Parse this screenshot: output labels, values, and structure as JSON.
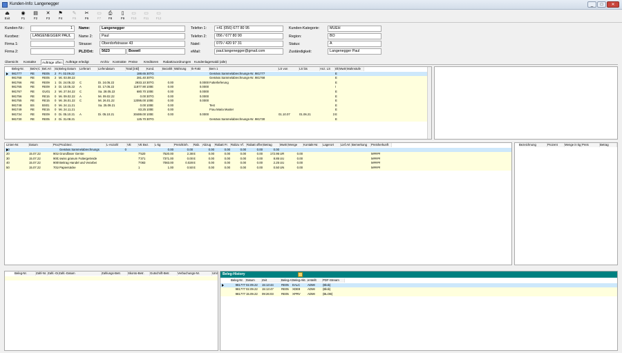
{
  "window": {
    "title": "Kunden-Info: Langenegger",
    "min": "_",
    "max": "□",
    "close": "✕"
  },
  "toolbar": [
    {
      "label": "Exit",
      "icon": "exit-icon",
      "glyph": "⏏",
      "enabled": true
    },
    {
      "label": "F1",
      "icon": "binoculars-icon",
      "glyph": "◉",
      "enabled": true
    },
    {
      "label": "F2",
      "icon": "new-icon",
      "glyph": "▤",
      "enabled": true
    },
    {
      "label": "F3",
      "icon": "delete-icon",
      "glyph": "✕",
      "enabled": true
    },
    {
      "label": "F4",
      "icon": "flag-icon",
      "glyph": "⚑",
      "enabled": true
    },
    {
      "label": "F5",
      "icon": "pin-icon",
      "glyph": "✎",
      "enabled": false
    },
    {
      "label": "F6",
      "icon": "tools-icon",
      "glyph": "✂",
      "enabled": true
    },
    {
      "label": "F7",
      "icon": "disabled-icon",
      "glyph": "▭",
      "enabled": false
    },
    {
      "label": "F8",
      "icon": "print-icon",
      "glyph": "⎙",
      "enabled": true
    },
    {
      "label": "F9",
      "icon": "document-icon",
      "glyph": "▯",
      "enabled": true
    },
    {
      "label": "F10",
      "icon": "disabled-icon",
      "glyph": "▭",
      "enabled": false
    },
    {
      "label": "F11",
      "icon": "disabled-icon",
      "glyph": "▭",
      "enabled": false
    },
    {
      "label": "F12",
      "icon": "disabled-icon",
      "glyph": "▭",
      "enabled": false
    }
  ],
  "customer": {
    "kundennr_label": "Kunden-Nr.:",
    "kundennr": "1",
    "kurzbez_label": "Kurzbez:",
    "kurzbez": "LANGENEGGER PAUL",
    "firma1_label": "Firma 1:",
    "firma1": "",
    "firma2_label": "Firma 2:",
    "firma2": "",
    "name_label": "Name:",
    "name": "Langenegger",
    "name2_label": "Name 2:",
    "name2": "Paul",
    "strasse_label": "Strasse:",
    "strasse": "Oberdorfstrasse 43",
    "plz_label": "PLZ/Ort:",
    "plz": "5623",
    "ort": "Boswil",
    "tel1_label": "Telefon 1:",
    "tel1": "+41 (056) 677 80 95",
    "tel2_label": "Telefon 2:",
    "tel2": "056 / 677 80 90",
    "natel_label": "Natel:",
    "natel": "079 / 420 97 31",
    "email_label": "eMail:",
    "email": "paul.langenegger@gmail.com",
    "kategorie_label": "Kunden-Kategorie:",
    "kategorie": "MUEH",
    "region_label": "Region:",
    "region": "BO",
    "status_label": "Status:",
    "status": "A",
    "zustaendig_label": "Zuständigkeit:",
    "zustaendig": "Langenegger Paul"
  },
  "tabs": [
    "Übersicht",
    "Kontakte",
    "Aufträge offen",
    "Aufträge erledigt",
    "Archiv",
    "Kontrakte",
    "Preise",
    "Kreditoren",
    "Rabattzuordnungen",
    "Kundenlagersaldi (alle)"
  ],
  "active_tab": 2,
  "orders": {
    "columns": [
      "Beleg-Nr.",
      "BelArt",
      "C",
      "Bel.Art",
      "Stat",
      "Beleg Datum",
      "Lieferart",
      "Liefendatum",
      "Total [inkl]",
      "Kond.",
      "Bezahlt",
      "Währung",
      "Ik-Fakt",
      "Bem 1",
      "LS von",
      "LS bis",
      "Anz. LS",
      "I/E",
      "MwSt.",
      "Mahnstufe"
    ],
    "rows": [
      [
        "981777",
        "RE",
        "",
        "RE05",
        "2",
        "Fr. 02.09.22",
        "",
        "",
        "188.65",
        "30TG",
        "",
        "",
        "",
        "Gemäss Sammelabrechnungs-Nr. 981777",
        "",
        "",
        "",
        "E",
        "",
        ""
      ],
      [
        "981768",
        "RE",
        "",
        "RE05",
        "2",
        "Mi. 03.08.22",
        "",
        "",
        "281.40",
        "30TG",
        "",
        "",
        "",
        "Gemäss Sammelabrechnungs-Nr. 981768",
        "",
        "",
        "",
        "E",
        "",
        ""
      ],
      [
        "981766",
        "RE",
        "",
        "RE09",
        "1",
        "Di. 24.05.22",
        "C",
        "Di. 24.05.22",
        "2933.10",
        "30TG",
        "0.00",
        "",
        "0.0000",
        "Futterlieferung",
        "",
        "",
        "",
        "E",
        "",
        ""
      ],
      [
        "981765",
        "RE",
        "",
        "RE09",
        "3",
        "Di. 10.05.22",
        "A",
        "Di. 17.05.22",
        "11877.90",
        "100E",
        "0.00",
        "",
        "0.0000",
        "",
        "",
        "",
        "",
        "I",
        "",
        ""
      ],
      [
        "981767",
        "RE",
        "",
        "GU01",
        "2",
        "Mi. 27.04.22",
        "C",
        "Sa. 28.05.22",
        "680.70",
        "100E",
        "0.00",
        "",
        "0.0000",
        "",
        "",
        "",
        "",
        "E",
        "",
        ""
      ],
      [
        "981756",
        "RE",
        "",
        "RE15",
        "0",
        "Mi. 09.02.22",
        "A",
        "Mi. 09.02.22",
        "0.00",
        "30TG",
        "0.00",
        "",
        "0.0000",
        "",
        "",
        "",
        "",
        "E",
        "",
        ""
      ],
      [
        "981755",
        "RE",
        "",
        "RE15",
        "0",
        "Mi. 26.01.22",
        "C",
        "Mi. 26.01.22",
        "12095.00",
        "100E",
        "0.00",
        "",
        "0.0000",
        "",
        "",
        "",
        "",
        "E",
        "",
        ""
      ],
      [
        "981748",
        "BS",
        "",
        "BS01",
        "0",
        "Mi. 24.11.21",
        "",
        "Sa. 25.09.21",
        "0.00",
        "100E",
        "0.00",
        "",
        "",
        "Test",
        "",
        "",
        "",
        "E",
        "",
        ""
      ],
      [
        "981749",
        "RE",
        "",
        "RE15",
        "0",
        "Mi. 24.11.21",
        "",
        "",
        "83.25",
        "100E",
        "0.00",
        "",
        "",
        "Frau Maria Muster",
        "",
        "",
        "",
        "E",
        "",
        ""
      ],
      [
        "981734",
        "RE",
        "",
        "RE09",
        "0",
        "Di. 05.10.21",
        "A",
        "Di. 05.10.21",
        "30489.00",
        "100E",
        "0.00",
        "",
        "0.0000",
        "",
        "01.10.07",
        "01.06.21",
        "3",
        "E",
        "",
        ""
      ],
      [
        "981730",
        "RE",
        "",
        "RE05",
        "2",
        "Di. 31.08.21",
        "",
        "",
        "125.70",
        "30TG",
        "",
        "",
        "",
        "Gemäss Sammelabrechnungs-Nr. 981730",
        "",
        "",
        "",
        "E",
        "",
        ""
      ]
    ]
  },
  "positions": {
    "columns": [
      "Linien-Nr.",
      "Datum",
      "Prod.-Nr.",
      "Prod.Bez.",
      "L-Anzahl",
      "VE",
      "VE Bez.",
      "L-kg",
      "Preis/Einh.",
      "Rab.",
      "Abzug",
      "Rabatt Fr.",
      "Rabzu Vf.",
      "Rabatt offen",
      "Betrag",
      "MwSt.",
      "Menge",
      "Kontakt-Nr.",
      "Lagerort",
      "Lief.Art",
      "Bemerkung",
      "Preisherkunft"
    ],
    "rows": [
      [
        "10",
        "",
        "",
        "Gemäss Sammelabrechnungs",
        "0",
        "",
        "",
        "0.00",
        "0.00",
        "",
        "0.00",
        "0.00",
        "0.00",
        "0.00",
        "0.00",
        "",
        "",
        "",
        "",
        "",
        "",
        ""
      ],
      [
        "20",
        "15.07.22",
        "9010",
        "Grundfaser Gerste",
        "",
        "",
        "7'520",
        "7520.00",
        "2.38",
        "E",
        "0.00",
        "0.00",
        "0.00",
        "0.00",
        "172.95",
        "UR",
        "0.00",
        "",
        "",
        "",
        "",
        "M####"
      ],
      [
        "30",
        "15.07.22",
        "9002",
        "swiss granum Futtergetreide",
        "",
        "",
        "7'371",
        "7371.00",
        "0.00",
        "E",
        "0.00",
        "0.00",
        "0.00",
        "0.00",
        "8.85",
        "UU",
        "0.00",
        "",
        "",
        "",
        "",
        "M####"
      ],
      [
        "40",
        "15.07.22",
        "9005",
        "Beitrag Handel und Verarbei",
        "",
        "",
        "7'083",
        "7083.00",
        "0.028",
        "E",
        "0.00",
        "0.00",
        "0.00",
        "0.00",
        "2.25",
        "UU",
        "0.00",
        "",
        "",
        "",
        "",
        "M####"
      ],
      [
        "50",
        "15.07.22",
        "7010",
        "Papiersäcke",
        "",
        "",
        "1",
        "1.00",
        "0.50",
        "E",
        "0.00",
        "0.00",
        "0.00",
        "0.00",
        "0.50",
        "UN",
        "0.00",
        "",
        "",
        "",
        "",
        "M####"
      ]
    ]
  },
  "discounts": {
    "columns": [
      "Bezeichnung",
      "Prozent",
      "Menge in kg",
      "Preis",
      "Betrag"
    ]
  },
  "payments": {
    "columns": [
      "Beleg-Nr.",
      "Zahl-Nr.",
      "Zahl.-Ort",
      "Zahl.-Datum",
      "Zahlungs-Betr.",
      "Skonto-Betr.",
      "Gutschrift-Betr.",
      "Verbuchungs-Nr.",
      "Umrect"
    ]
  },
  "history": {
    "title": "Beleg-History",
    "columns": [
      "Beleg-Nr.",
      "Datum",
      "Zeit",
      "Beleg-Art",
      "Beleg-Akt.",
      "erstellt",
      "PDF-Stream"
    ],
    "rows": [
      [
        "981777",
        "02.09.22",
        "15:13:44",
        "RE05",
        "EALC",
        "ADMI",
        "(Blob)"
      ],
      [
        "981777",
        "02.09.22",
        "15:13:47",
        "RE05",
        "XDE8",
        "ADMI",
        "(Blob)"
      ],
      [
        "981777",
        "15.09.22",
        "09:26:03",
        "RE05",
        "XPRV",
        "ADMI",
        "(BLOB)"
      ]
    ]
  }
}
